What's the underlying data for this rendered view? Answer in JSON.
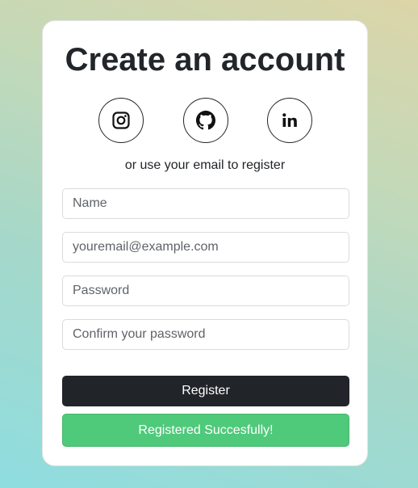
{
  "form": {
    "title": "Create an account",
    "social": [
      {
        "name": "instagram",
        "icon": "instagram-icon"
      },
      {
        "name": "github",
        "icon": "github-icon"
      },
      {
        "name": "linkedin",
        "icon": "linkedin-icon"
      }
    ],
    "subtitle": "or use your email to register",
    "name_placeholder": "Name",
    "email_placeholder": "youremail@example.com",
    "password_placeholder": "Password",
    "confirm_placeholder": "Confirm your password",
    "register_label": "Register",
    "success_message": "Registered Succesfully!"
  },
  "colors": {
    "button_dark": "#212529",
    "success": "#4fc97a"
  }
}
